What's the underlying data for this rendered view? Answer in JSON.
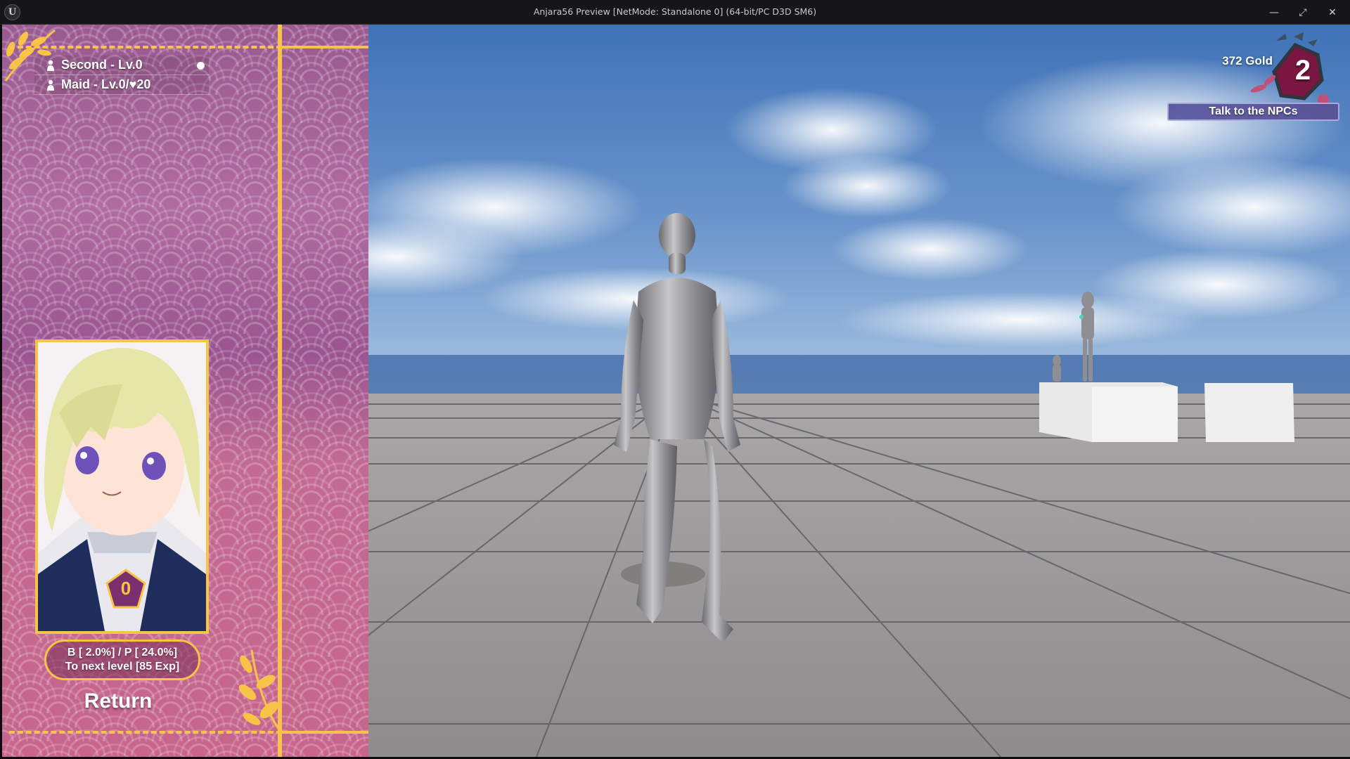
{
  "window": {
    "title": "Anjara56 Preview [NetMode: Standalone 0]  (64-bit/PC D3D SM6)",
    "app_icon": "unreal-engine-logo",
    "app_icon_text": "U",
    "controls": {
      "minimize": "—",
      "restore": "⤢",
      "close": "✕"
    }
  },
  "party": {
    "members": [
      {
        "label": "Second - Lv.0",
        "icon": "person-icon",
        "selected": true
      },
      {
        "label_prefix": "Maid - Lv.0/",
        "heart_icon": "♥",
        "affection": "20",
        "icon": "person-icon",
        "selected": false
      }
    ]
  },
  "character": {
    "level": "0",
    "stats_line1": "B [ 2.0%] / P [ 24.0%]",
    "stats_line2": "To next level [85 Exp]"
  },
  "menu": {
    "return_label": "Return"
  },
  "hud": {
    "gold": "372 Gold",
    "day": "2",
    "quest": "Talk to the NPCs"
  },
  "colors": {
    "accent_gold": "#f7c447",
    "panel_pink": "#b06ba0",
    "quest_bar": "#4a4a96",
    "hex_badge": "#7a1640"
  }
}
